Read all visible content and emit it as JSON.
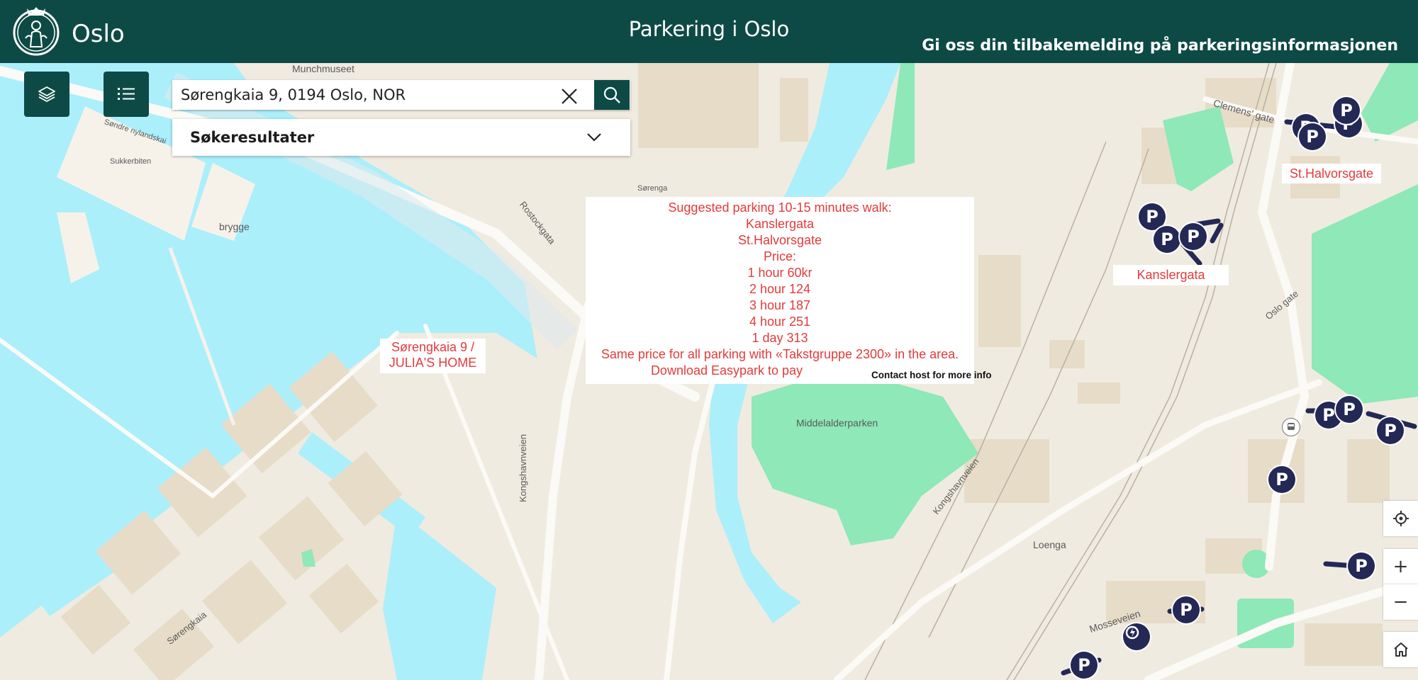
{
  "header": {
    "logo_text": "Oslo",
    "title": "Parkering i Oslo",
    "feedback_link": "Gi oss din tilbakemelding på parkeringsinformasjonen",
    "background_color": "#0e4a45"
  },
  "toolbar": {
    "layers_icon": "layers-icon",
    "list_icon": "list-icon"
  },
  "search": {
    "value": "Sørengkaia 9, 0194 Oslo, NOR",
    "clear_icon": "close-icon",
    "search_icon": "search-icon"
  },
  "results": {
    "label": "Søkeresultater",
    "toggle_icon": "chevron-down-icon"
  },
  "note": {
    "lines": [
      "Suggested parking 10-15 minutes walk:",
      "Kanslergata",
      "St.Halvorsgate",
      "Price:",
      "1 hour 60kr",
      "2 hour 124",
      "3 hour 187",
      "4 hour 251",
      "1 day 313",
      "Same price for all parking with «Takstgruppe 2300» in the area.",
      "Download Easypark to pay"
    ],
    "contact": "Contact host for more info",
    "text_color": "#e33b3b"
  },
  "map_labels": {
    "home_line1": "Sørengkaia 9 /",
    "home_line2": "JULIA'S HOME",
    "kanslergata": "Kanslergata",
    "st_halvorsgate": "St.Halvorsgate"
  },
  "streets": {
    "munchmuseet": "Munchmuseet",
    "sukkerbiten": "Sukkerbiten",
    "sondre": "Søndre nylandskai",
    "brygge": "brygge",
    "sorenga": "Sørenga",
    "rostockgata": "Rostockgata",
    "clemens": "Clemens' gate",
    "oslo_gate": "Oslo gate",
    "middelalderparken": "Middelalderparken",
    "kongshavnveien": "Kongshavnveien",
    "loenga": "Loenga",
    "mosseveien": "Mosseveien",
    "sorengkaia": "Sørengkaia",
    "kongshavnveien2": "Kongshavnveien"
  },
  "parking_marker_label": "P",
  "map_controls": {
    "locate_icon": "locate-icon",
    "zoom_in": "+",
    "zoom_out": "−",
    "home_icon": "home-icon"
  },
  "colors": {
    "water": "#abeffb",
    "land": "#f0ebe0",
    "park": "#8ee8b8",
    "marker": "#232855"
  }
}
